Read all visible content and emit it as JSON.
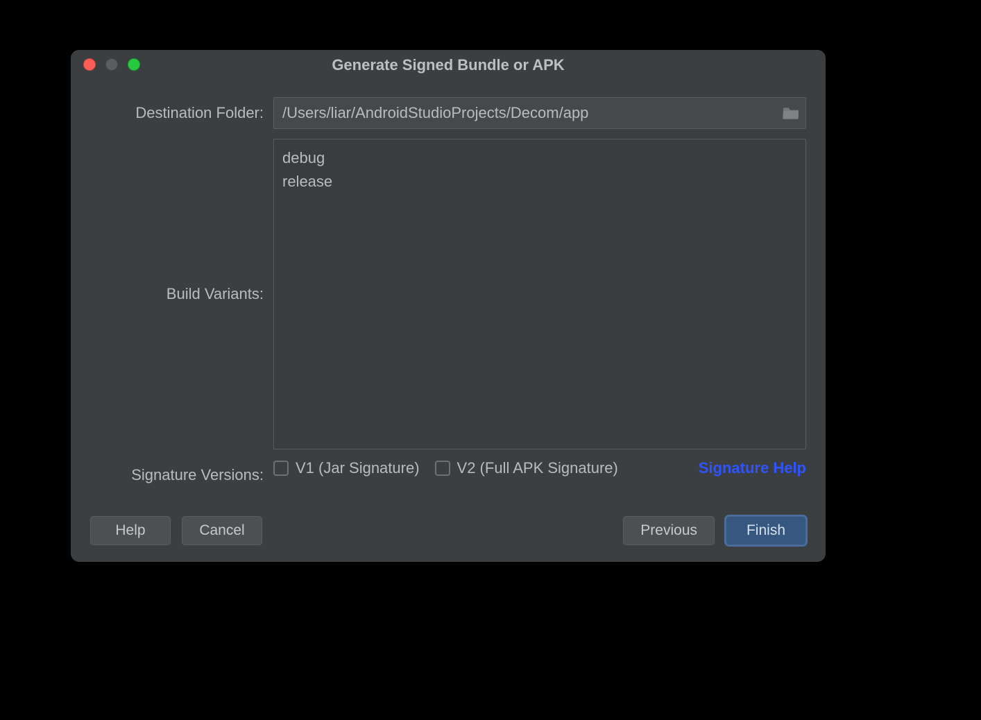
{
  "title": "Generate Signed Bundle or APK",
  "labels": {
    "destination": "Destination Folder:",
    "variants": "Build Variants:",
    "sigversions": "Signature Versions:"
  },
  "destination_path": "/Users/liar/AndroidStudioProjects/Decom/app",
  "variants": [
    "debug",
    "release"
  ],
  "signature": {
    "v1_label": "V1 (Jar Signature)",
    "v2_label": "V2 (Full APK Signature)",
    "help_link": "Signature Help",
    "v1_checked": false,
    "v2_checked": false
  },
  "buttons": {
    "help": "Help",
    "cancel": "Cancel",
    "previous": "Previous",
    "finish": "Finish"
  },
  "colors": {
    "dialog_bg": "#3c3f41",
    "field_bg": "#45494a",
    "link": "#2f54ff",
    "primary_btn": "#365880"
  }
}
